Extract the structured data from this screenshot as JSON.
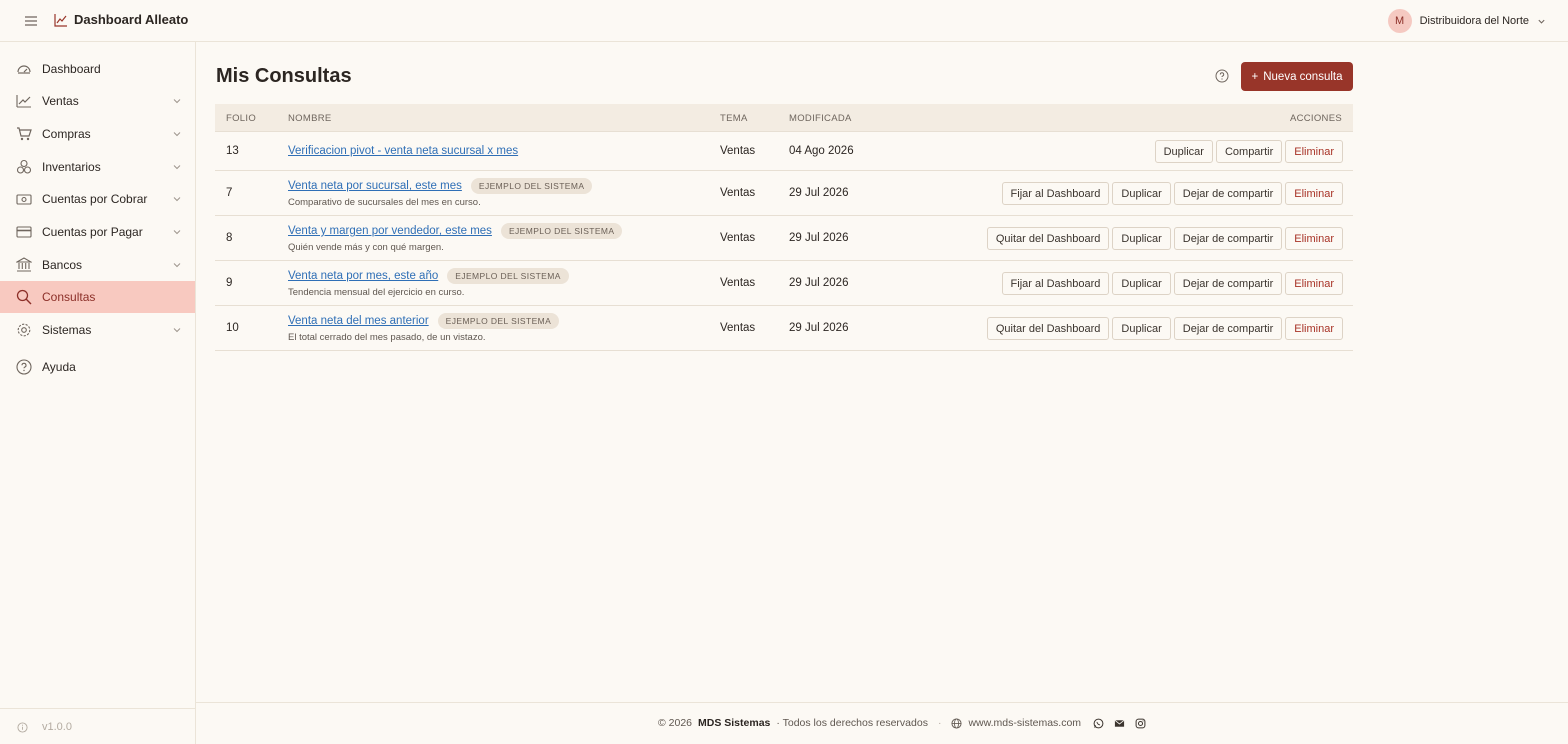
{
  "app": {
    "title": "Dashboard Alleato"
  },
  "account": {
    "initial": "M",
    "name": "Distribuidora del Norte"
  },
  "sidebar": {
    "items": [
      {
        "label": "Dashboard",
        "icon": "gauge-icon",
        "has_children": false
      },
      {
        "label": "Ventas",
        "icon": "trending-up-icon",
        "has_children": true
      },
      {
        "label": "Compras",
        "icon": "cart-icon",
        "has_children": true
      },
      {
        "label": "Inventarios",
        "icon": "boxes-icon",
        "has_children": true
      },
      {
        "label": "Cuentas por Cobrar",
        "icon": "cash-icon",
        "has_children": true
      },
      {
        "label": "Cuentas por Pagar",
        "icon": "credit-card-icon",
        "has_children": true
      },
      {
        "label": "Bancos",
        "icon": "bank-icon",
        "has_children": true
      },
      {
        "label": "Consultas",
        "icon": "search-icon",
        "has_children": false,
        "active": true
      },
      {
        "label": "Sistemas",
        "icon": "gear-icon",
        "has_children": true
      },
      {
        "label": "Ayuda",
        "icon": "help-circle-icon",
        "has_children": false
      }
    ],
    "version": "v1.0.0"
  },
  "main": {
    "title": "Mis Consultas",
    "new_button": "Nueva consulta",
    "new_button_icon": "+"
  },
  "table": {
    "headers": {
      "folio": "FOLIO",
      "nombre": "NOMBRE",
      "tema": "TEMA",
      "modificada": "MODIFICADA",
      "acciones": "ACCIONES"
    },
    "badge_label": "EJEMPLO DEL SISTEMA",
    "rows": [
      {
        "folio": "13",
        "nombre": "Verificacion pivot - venta neta sucursal x mes",
        "descripcion": "",
        "ejemplo": false,
        "tema": "Ventas",
        "modificada": "04 Ago 2026",
        "actions": [
          "Duplicar",
          "Compartir",
          "Eliminar"
        ]
      },
      {
        "folio": "7",
        "nombre": "Venta neta por sucursal, este mes",
        "descripcion": "Comparativo de sucursales del mes en curso.",
        "ejemplo": true,
        "tema": "Ventas",
        "modificada": "29 Jul 2026",
        "actions": [
          "Fijar al Dashboard",
          "Duplicar",
          "Dejar de compartir",
          "Eliminar"
        ]
      },
      {
        "folio": "8",
        "nombre": "Venta y margen por vendedor, este mes",
        "descripcion": "Quién vende más y con qué margen.",
        "ejemplo": true,
        "tema": "Ventas",
        "modificada": "29 Jul 2026",
        "actions": [
          "Quitar del Dashboard",
          "Duplicar",
          "Dejar de compartir",
          "Eliminar"
        ]
      },
      {
        "folio": "9",
        "nombre": "Venta neta por mes, este año",
        "descripcion": "Tendencia mensual del ejercicio en curso.",
        "ejemplo": true,
        "tema": "Ventas",
        "modificada": "29 Jul 2026",
        "actions": [
          "Fijar al Dashboard",
          "Duplicar",
          "Dejar de compartir",
          "Eliminar"
        ]
      },
      {
        "folio": "10",
        "nombre": "Venta neta del mes anterior",
        "descripcion": "El total cerrado del mes pasado, de un vistazo.",
        "ejemplo": true,
        "tema": "Ventas",
        "modificada": "29 Jul 2026",
        "actions": [
          "Quitar del Dashboard",
          "Duplicar",
          "Dejar de compartir",
          "Eliminar"
        ]
      }
    ]
  },
  "footer": {
    "copyright": "© 2026",
    "company": "MDS Sistemas",
    "rights": "· Todos los derechos reservados",
    "separator": "·",
    "website": "www.mds-sistemas.com",
    "social": [
      "whatsapp-icon",
      "mail-icon",
      "instagram-icon"
    ]
  },
  "colors": {
    "accent": "#983529",
    "active_bg": "#f8c9c0",
    "link": "#2f6fb6",
    "danger": "#a83327"
  }
}
